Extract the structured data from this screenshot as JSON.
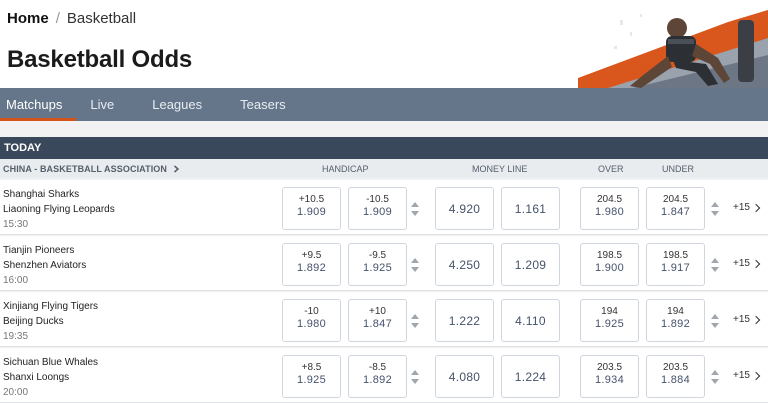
{
  "breadcrumb": {
    "home": "Home",
    "separator": "/",
    "current": "Basketball"
  },
  "page_title": "Basketball Odds",
  "nav": {
    "tabs": [
      {
        "label": "Matchups",
        "active": true
      },
      {
        "label": "Live",
        "active": false
      },
      {
        "label": "Leagues",
        "active": false
      },
      {
        "label": "Teasers",
        "active": false
      }
    ]
  },
  "section": "TODAY",
  "league": "CHINA - BASKETBALL ASSOCIATION",
  "columns": {
    "handicap": "HANDICAP",
    "money_line": "MONEY LINE",
    "over": "OVER",
    "under": "UNDER"
  },
  "colors": {
    "accent": "#d2541c",
    "nav_bg": "#65768a",
    "section_bg": "#39485a"
  },
  "matches": [
    {
      "home": "Shanghai Sharks",
      "away": "Liaoning Flying Leopards",
      "time": "15:30",
      "handicap": [
        {
          "line": "+10.5",
          "price": "1.909"
        },
        {
          "line": "-10.5",
          "price": "1.909"
        }
      ],
      "moneyline": [
        "4.920",
        "1.161"
      ],
      "over": {
        "line": "204.5",
        "price": "1.980"
      },
      "under": {
        "line": "204.5",
        "price": "1.847"
      },
      "more": "+15"
    },
    {
      "home": "Tianjin Pioneers",
      "away": "Shenzhen Aviators",
      "time": "16:00",
      "handicap": [
        {
          "line": "+9.5",
          "price": "1.892"
        },
        {
          "line": "-9.5",
          "price": "1.925"
        }
      ],
      "moneyline": [
        "4.250",
        "1.209"
      ],
      "over": {
        "line": "198.5",
        "price": "1.900"
      },
      "under": {
        "line": "198.5",
        "price": "1.917"
      },
      "more": "+15"
    },
    {
      "home": "Xinjiang Flying Tigers",
      "away": "Beijing Ducks",
      "time": "19:35",
      "handicap": [
        {
          "line": "-10",
          "price": "1.980"
        },
        {
          "line": "+10",
          "price": "1.847"
        }
      ],
      "moneyline": [
        "1.222",
        "4.110"
      ],
      "over": {
        "line": "194",
        "price": "1.925"
      },
      "under": {
        "line": "194",
        "price": "1.892"
      },
      "more": "+15"
    },
    {
      "home": "Sichuan Blue Whales",
      "away": "Shanxi Loongs",
      "time": "20:00",
      "handicap": [
        {
          "line": "+8.5",
          "price": "1.925"
        },
        {
          "line": "-8.5",
          "price": "1.892"
        }
      ],
      "moneyline": [
        "4.080",
        "1.224"
      ],
      "over": {
        "line": "203.5",
        "price": "1.934"
      },
      "under": {
        "line": "203.5",
        "price": "1.884"
      },
      "more": "+15"
    }
  ]
}
